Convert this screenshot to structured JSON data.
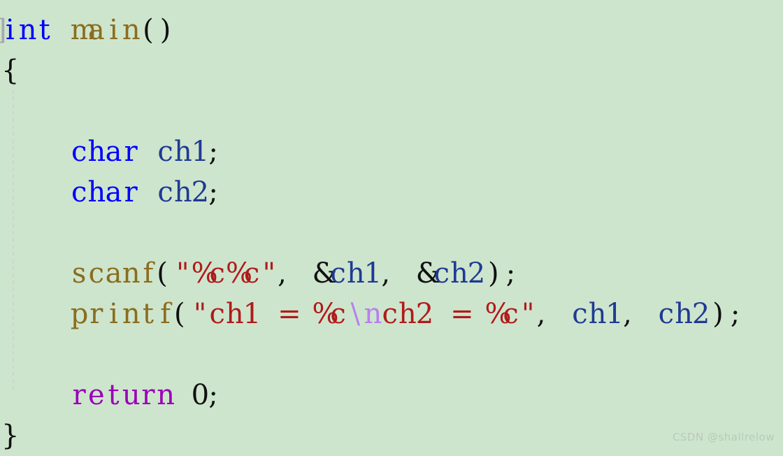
{
  "editor": {
    "background_color": "#cee5cd",
    "language": "c",
    "indent_guide_color": "#d9c9cf",
    "left_clipped_fragment": "]"
  },
  "colors": {
    "keyword_type": "#0000ff",
    "keyword_return": "#9a00b8",
    "function": "#8a6d1f",
    "identifier": "#1f3a93",
    "string": "#b01a1a",
    "escape": "#b77ff0",
    "punctuation": "#101010",
    "watermark": "#b9c9b6"
  },
  "code_lines": [
    {
      "number": 1,
      "indent": 0,
      "text": "int main()",
      "tokens": [
        {
          "t": "int",
          "c": "kw-type"
        },
        {
          "t": " ",
          "c": "punc"
        },
        {
          "t": "main",
          "c": "fn"
        },
        {
          "t": "()",
          "c": "punc"
        }
      ]
    },
    {
      "number": 2,
      "indent": 0,
      "text": "{",
      "tokens": [
        {
          "t": "{",
          "c": "punc"
        }
      ]
    },
    {
      "number": 3,
      "indent": 0,
      "text": "",
      "tokens": []
    },
    {
      "number": 4,
      "indent": 4,
      "text": "    char ch1;",
      "tokens": [
        {
          "t": "    ",
          "c": "punc"
        },
        {
          "t": "char",
          "c": "kw-type"
        },
        {
          "t": " ",
          "c": "punc"
        },
        {
          "t": "ch1",
          "c": "ident"
        },
        {
          "t": ";",
          "c": "punc"
        }
      ]
    },
    {
      "number": 5,
      "indent": 4,
      "text": "    char ch2;",
      "tokens": [
        {
          "t": "    ",
          "c": "punc"
        },
        {
          "t": "char",
          "c": "kw-type"
        },
        {
          "t": " ",
          "c": "punc"
        },
        {
          "t": "ch2",
          "c": "ident"
        },
        {
          "t": ";",
          "c": "punc"
        }
      ]
    },
    {
      "number": 6,
      "indent": 0,
      "text": "",
      "tokens": []
    },
    {
      "number": 7,
      "indent": 4,
      "text": "    scanf(\"%c%c\", &ch1, &ch2);",
      "tokens": [
        {
          "t": "    ",
          "c": "punc"
        },
        {
          "t": "scanf",
          "c": "fn"
        },
        {
          "t": "(",
          "c": "punc"
        },
        {
          "t": "\"%c%c\"",
          "c": "str"
        },
        {
          "t": ", ",
          "c": "punc"
        },
        {
          "t": "&",
          "c": "punc"
        },
        {
          "t": "ch1",
          "c": "ident"
        },
        {
          "t": ", ",
          "c": "punc"
        },
        {
          "t": "&",
          "c": "punc"
        },
        {
          "t": "ch2",
          "c": "ident"
        },
        {
          "t": ");",
          "c": "punc"
        }
      ]
    },
    {
      "number": 8,
      "indent": 4,
      "text": "    printf(\"ch1 = %c\\nch2 = %c\", ch1, ch2);",
      "tokens": [
        {
          "t": "    ",
          "c": "punc"
        },
        {
          "t": "printf",
          "c": "fn"
        },
        {
          "t": "(",
          "c": "punc"
        },
        {
          "t": "\"ch1 = %c",
          "c": "str"
        },
        {
          "t": "\\n",
          "c": "esc"
        },
        {
          "t": "ch2 = %c\"",
          "c": "str"
        },
        {
          "t": ", ",
          "c": "punc"
        },
        {
          "t": "ch1",
          "c": "ident"
        },
        {
          "t": ", ",
          "c": "punc"
        },
        {
          "t": "ch2",
          "c": "ident"
        },
        {
          "t": ");",
          "c": "punc"
        }
      ]
    },
    {
      "number": 9,
      "indent": 0,
      "text": "",
      "tokens": []
    },
    {
      "number": 10,
      "indent": 4,
      "text": "    return 0;",
      "tokens": [
        {
          "t": "    ",
          "c": "punc"
        },
        {
          "t": "return",
          "c": "kw-return"
        },
        {
          "t": " ",
          "c": "punc"
        },
        {
          "t": "0",
          "c": "num"
        },
        {
          "t": ";",
          "c": "punc"
        }
      ]
    },
    {
      "number": 11,
      "indent": 0,
      "text": "}",
      "tokens": [
        {
          "t": "}",
          "c": "punc"
        }
      ]
    }
  ],
  "watermark": {
    "text": "CSDN @shallrelow"
  }
}
